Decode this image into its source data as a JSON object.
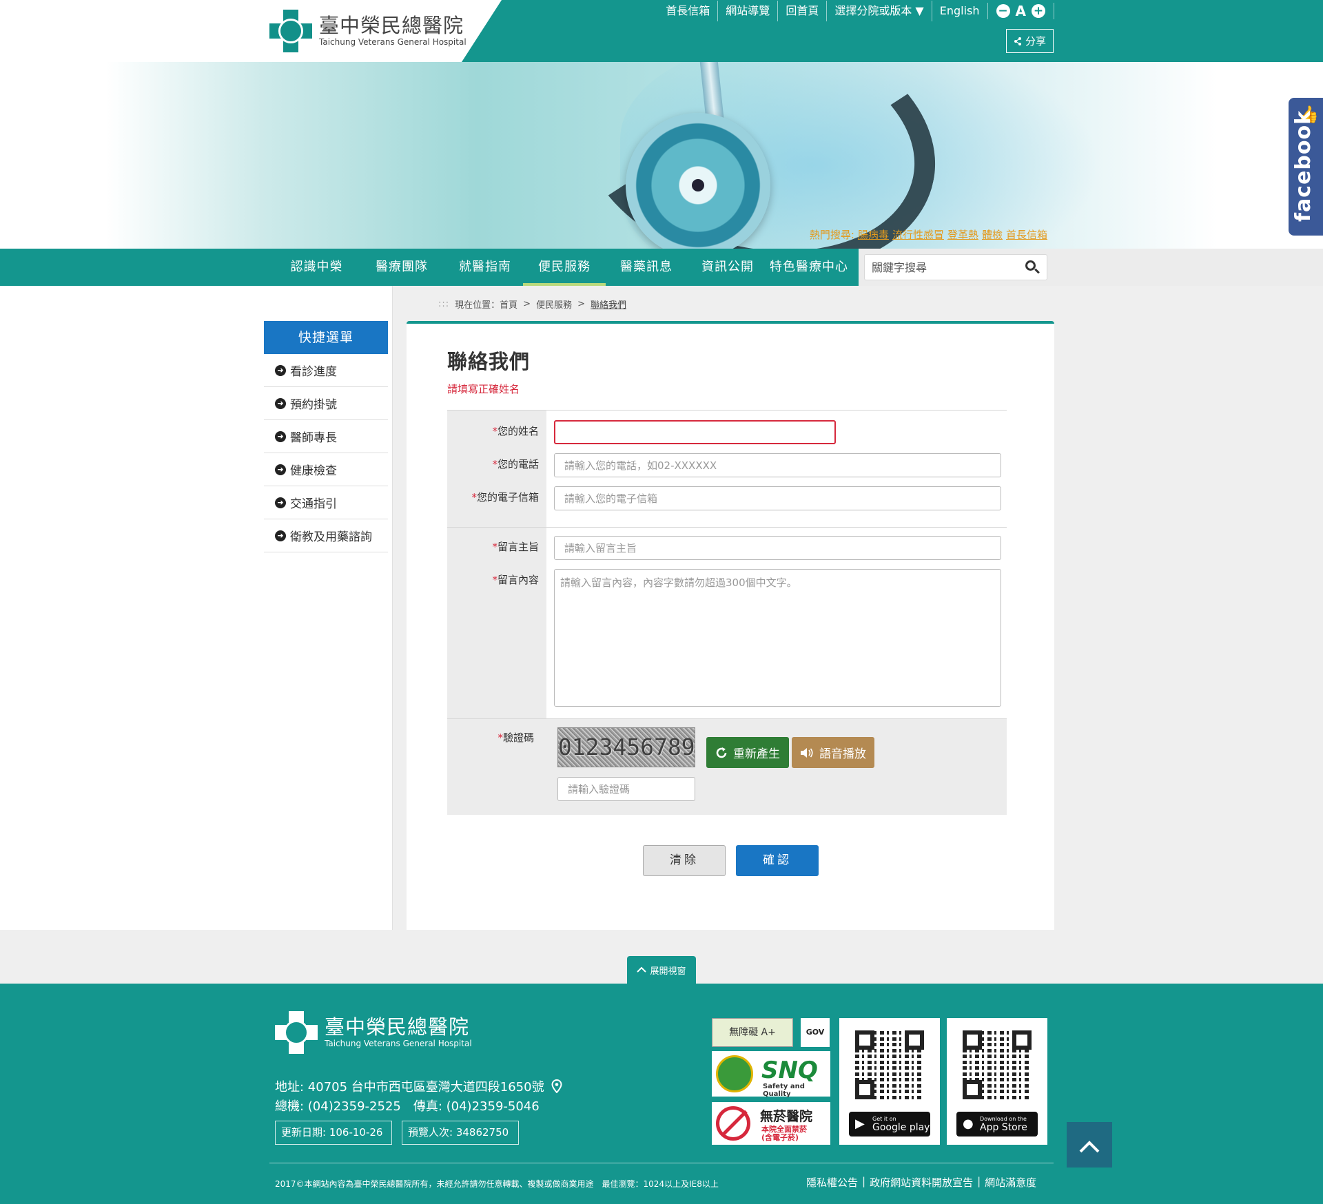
{
  "header": {
    "logo_zh": "臺中榮民總醫院",
    "logo_en": "Taichung Veterans General Hospital",
    "top_links": [
      "首長信箱",
      "網站導覽",
      "回首頁",
      "選擇分院或版本 ▼",
      "English"
    ],
    "font_decrease": "−",
    "font_label": "A",
    "font_increase": "+",
    "share_label": "分享"
  },
  "banner": {
    "hot_search_label": "熱門搜尋:",
    "hot_keywords": [
      "腸病毒",
      "流行性感冒",
      "登革熱",
      "體檢",
      "首長信箱"
    ]
  },
  "main_nav": {
    "items": [
      "認識中榮",
      "醫療團隊",
      "就醫指南",
      "便民服務",
      "醫藥訊息",
      "資訊公開",
      "特色醫療中心"
    ],
    "active_index": 3,
    "search_placeholder": "關鍵字搜尋"
  },
  "facebook_tab": {
    "label": "facebook"
  },
  "breadcrumb": {
    "dots": ":::",
    "prefix": "現在位置：",
    "items": [
      "首頁",
      "便民服務",
      "聯絡我們"
    ],
    "sep": ">"
  },
  "sidebar": {
    "title": "快捷選單",
    "items": [
      "看診進度",
      "預約掛號",
      "醫師專長",
      "健康檢查",
      "交通指引",
      "衛教及用藥諮詢"
    ]
  },
  "form": {
    "title": "聯絡我們",
    "error": "請填寫正確姓名",
    "required_mark": "*",
    "name_label": "您的姓名",
    "name_value": "",
    "phone_label": "您的電話",
    "phone_placeholder": "請輸入您的電話，如02-XXXXXX",
    "email_label": "您的電子信箱",
    "email_placeholder": "請輸入您的電子信箱",
    "subject_label": "留言主旨",
    "subject_placeholder": "請輸入留言主旨",
    "message_label": "留言內容",
    "message_placeholder": "請輸入留言內容，內容字數請勿超過300個中文字。",
    "captcha_label": "驗證碼",
    "captcha_text": "0123456789",
    "regenerate_label": "重新產生",
    "audio_label": "語音播放",
    "captcha_placeholder": "請輸入驗證碼",
    "clear_label": "清除",
    "confirm_label": "確認"
  },
  "expand_tab": {
    "label": "展開視窗"
  },
  "footer": {
    "logo_zh": "臺中榮民總醫院",
    "logo_en": "Taichung Veterans General Hospital",
    "address": "地址: 40705 台中市西屯區臺灣大道四段1650號",
    "phone": "總機: (04)2359-2525　傳真: (04)2359-5046",
    "updated": "更新日期: 106-10-26",
    "visits": "預覽人次: 34862750",
    "badge_a11y": "無障礙 A+",
    "badge_gov": "GOV",
    "snq_title": "SNQ",
    "snq_sub": "Safety and Quality",
    "smoke_title": "無菸醫院",
    "smoke_sub1": "本院全面禁菸",
    "smoke_sub2": "(含電子菸)",
    "google_small": "Get it on",
    "google_big": "Google play",
    "apple_small": "Download on the",
    "apple_big": "App Store",
    "copyright": "2017©本網站內容為臺中榮民總醫院所有，未經允許請勿任意轉載、複製或做商業用途　最佳瀏覽：1024以上及IE8以上",
    "links": [
      "隱私權公告",
      "政府網站資料開放宣告",
      "網站滿意度"
    ]
  }
}
